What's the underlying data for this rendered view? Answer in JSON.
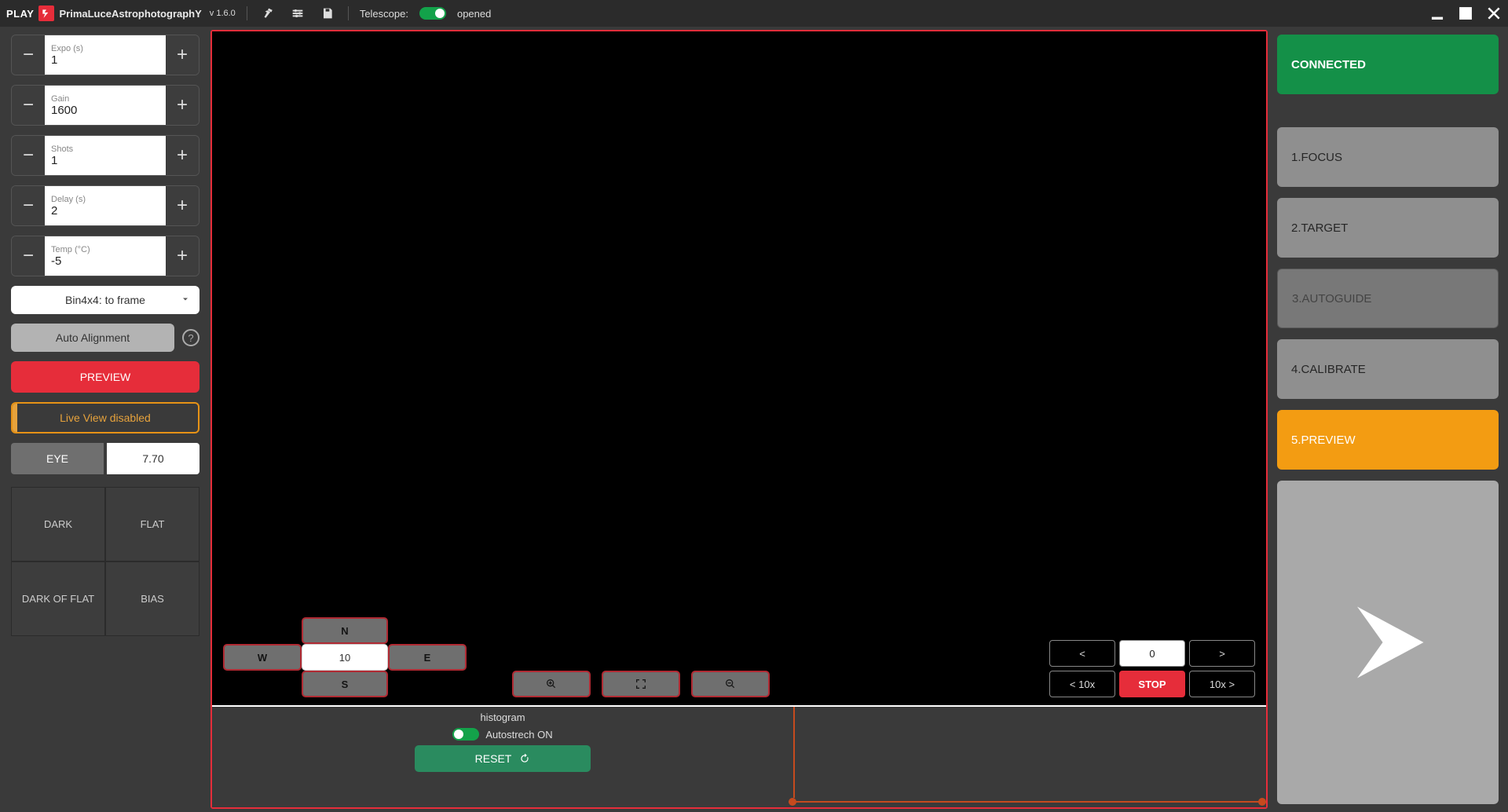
{
  "topbar": {
    "play": "PLAY",
    "brand": "PrimaLuceAstrophotographY",
    "version": "v 1.6.0",
    "telescope_label": "Telescope:",
    "telescope_state": "opened"
  },
  "left": {
    "expo": {
      "label": "Expo (s)",
      "value": "1"
    },
    "gain": {
      "label": "Gain",
      "value": "1600"
    },
    "shots": {
      "label": "Shots",
      "value": "1"
    },
    "delay": {
      "label": "Delay (s)",
      "value": "2"
    },
    "temp": {
      "label": "Temp (°C)",
      "value": "-5"
    },
    "binning": "Bin4x4: to frame",
    "auto_align": "Auto Alignment",
    "preview": "PREVIEW",
    "live_view": "Live View disabled",
    "eye_label": "EYE",
    "eye_value": "7.70",
    "quad": {
      "dark": "DARK",
      "flat": "FLAT",
      "dark_of_flat": "DARK OF FLAT",
      "bias": "BIAS"
    }
  },
  "center": {
    "dpad": {
      "n": "N",
      "w": "W",
      "e": "E",
      "s": "S",
      "speed": "10"
    },
    "rot": {
      "left": "<",
      "value": "0",
      "right": ">",
      "left10": "< 10x",
      "stop": "STOP",
      "right10": "10x >"
    },
    "histogram": {
      "title": "histogram",
      "autostretch": "Autostrech ON",
      "reset": "RESET"
    }
  },
  "right": {
    "connected": "CONNECTED",
    "steps": [
      "1.FOCUS",
      "2.TARGET",
      "3.AUTOGUIDE",
      "4.CALIBRATE",
      "5.PREVIEW"
    ]
  }
}
